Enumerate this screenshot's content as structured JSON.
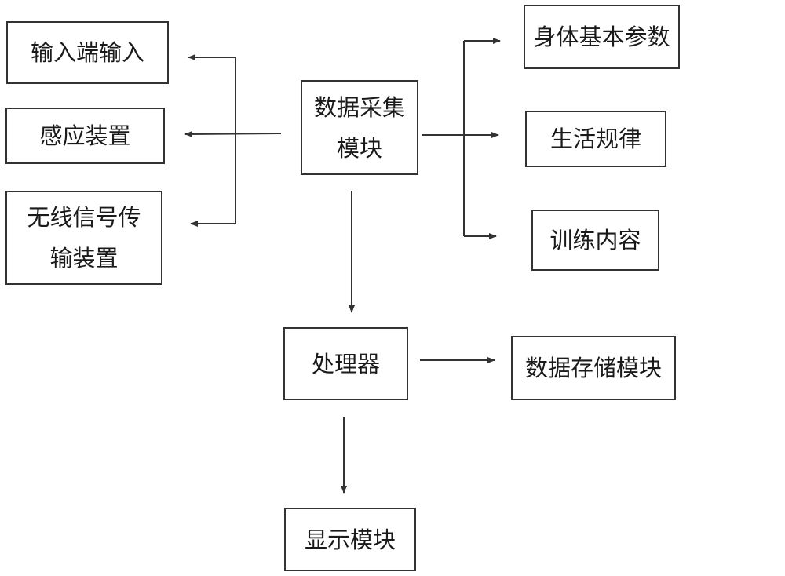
{
  "diagram": {
    "type": "flowchart",
    "nodes": {
      "input_terminal": "输入端输入",
      "sensor_device": "感应装置",
      "wireless_transmitter": "无线信号传输装置",
      "data_acquisition": "数据采集模块",
      "body_params": "身体基本参数",
      "life_routine": "生活规律",
      "training_content": "训练内容",
      "processor": "处理器",
      "data_storage": "数据存储模块",
      "display": "显示模块"
    },
    "labels": {
      "wireless_line1": "无线信号传",
      "wireless_line2": "输装置",
      "acq_line1": "数据采集",
      "acq_line2": "模块"
    },
    "edges": [
      {
        "from": "数据采集模块",
        "to": "输入端输入"
      },
      {
        "from": "数据采集模块",
        "to": "感应装置"
      },
      {
        "from": "数据采集模块",
        "to": "无线信号传输装置"
      },
      {
        "from": "数据采集模块",
        "to": "身体基本参数"
      },
      {
        "from": "数据采集模块",
        "to": "生活规律"
      },
      {
        "from": "数据采集模块",
        "to": "训练内容"
      },
      {
        "from": "数据采集模块",
        "to": "处理器"
      },
      {
        "from": "处理器",
        "to": "数据存储模块"
      },
      {
        "from": "处理器",
        "to": "显示模块"
      }
    ]
  }
}
